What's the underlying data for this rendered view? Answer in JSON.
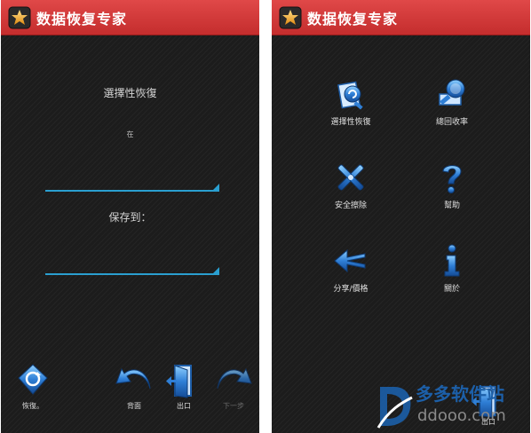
{
  "app": {
    "title": "数据恢复专家"
  },
  "left_screen": {
    "heading": "選擇性恢復",
    "in_label": "在",
    "save_label": "保存到：",
    "bottom_bar": [
      {
        "label": "恢復。",
        "icon": "recycle-icon",
        "enabled": true
      },
      {
        "label": "背面",
        "icon": "back-arrow-icon",
        "enabled": true
      },
      {
        "label": "出口",
        "icon": "exit-door-icon",
        "enabled": true
      },
      {
        "label": "下一步",
        "icon": "next-arrow-icon",
        "enabled": false
      }
    ]
  },
  "right_screen": {
    "menu": [
      {
        "label": "選擇性恢復",
        "icon": "selective-recovery-icon"
      },
      {
        "label": "總回收率",
        "icon": "total-recovery-icon"
      },
      {
        "label": "安全擦除",
        "icon": "secure-erase-icon"
      },
      {
        "label": "幫助",
        "icon": "help-icon"
      },
      {
        "label": "分享/價格",
        "icon": "share-icon"
      },
      {
        "label": "關於",
        "icon": "info-icon"
      }
    ],
    "exit_label": "出口"
  },
  "watermark": {
    "title": "多多软件站",
    "url": "ddooo.com"
  },
  "colors": {
    "titlebar": "#d63b3b",
    "background": "#1c1c1c",
    "accent": "#2a9fd0",
    "icon_blue": "#2f7fd6",
    "watermark_blue": "#1c5fa8"
  }
}
